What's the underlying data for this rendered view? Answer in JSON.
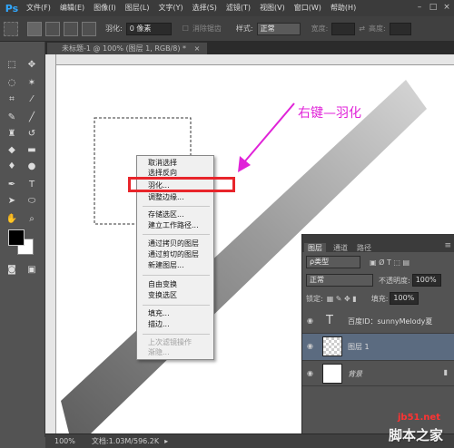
{
  "app": {
    "logo": "Ps"
  },
  "menu": [
    "文件(F)",
    "编辑(E)",
    "图像(I)",
    "图层(L)",
    "文字(Y)",
    "选择(S)",
    "滤镜(T)",
    "视图(V)",
    "窗口(W)",
    "帮助(H)"
  ],
  "options": {
    "feather_label": "羽化:",
    "feather_value": "0 像素",
    "antialias_label": "消除锯齿",
    "style_label": "样式:",
    "style_value": "正常",
    "width_label": "宽度:",
    "height_label": "高度:"
  },
  "document": {
    "tab_title": "未标题-1 @ 100% (图层 1, RGB/8) *",
    "close_glyph": "×"
  },
  "context_menu": {
    "items": [
      "取消选择",
      "选择反向",
      "羽化...",
      "调整边缘...",
      "存储选区...",
      "建立工作路径...",
      "通过拷贝的图层",
      "通过剪切的图层",
      "新建图层...",
      "自由变换",
      "变换选区",
      "填充...",
      "描边...",
      "上次滤镜操作",
      "渐隐..."
    ]
  },
  "annotation": "右键—羽化",
  "status": {
    "zoom": "100%",
    "doc_info": "文档:1.03M/596.2K"
  },
  "layers_panel": {
    "tabs": [
      "图层",
      "通道",
      "路径"
    ],
    "filter": "ρ类型",
    "blend_mode": "正常",
    "opacity_label": "不透明度:",
    "opacity_value": "100%",
    "lock_label": "锁定:",
    "fill_label": "填充:",
    "fill_value": "100%",
    "layers": [
      {
        "name": "百度ID：sunnyMelody夏",
        "kind": "text"
      },
      {
        "name": "图层 1",
        "kind": "pixel",
        "selected": true
      },
      {
        "name": "背景",
        "kind": "background"
      }
    ]
  },
  "watermark": {
    "site": "jb51.net",
    "name": "脚本之家"
  },
  "colors": {
    "accent_ps": "#31a8ff",
    "highlight_red": "#e8252b",
    "annotation_magenta": "#e022d8",
    "layer_selected": "#5b6b80"
  }
}
